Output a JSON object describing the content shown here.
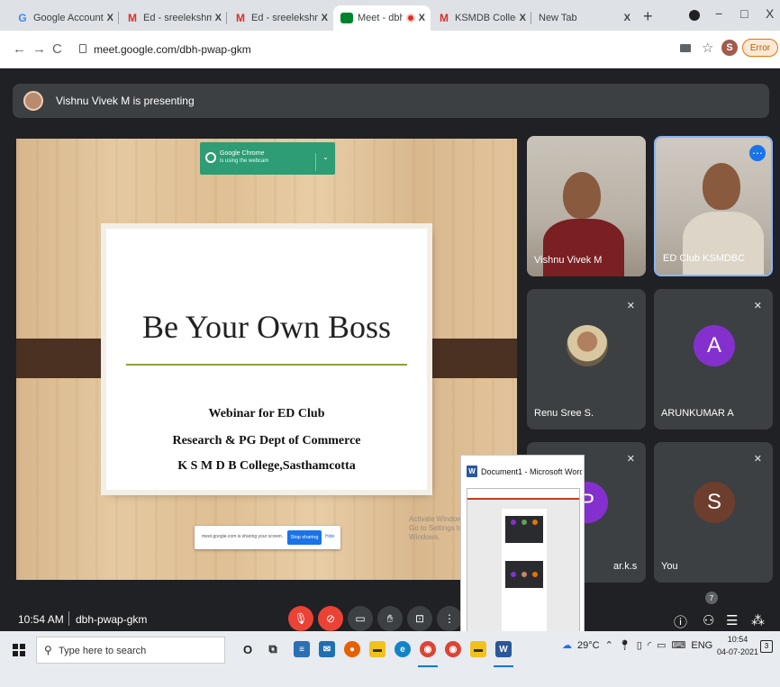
{
  "browser": {
    "tabs": [
      {
        "title": "Google Account",
        "favicon": "google-icon",
        "active": false
      },
      {
        "title": "Ed - sreelekshmyhg@",
        "favicon": "gmail-icon",
        "active": false
      },
      {
        "title": "Ed - sreelekshmyhg@",
        "favicon": "gmail-icon",
        "active": false
      },
      {
        "title": "Meet - dbh-pwap-",
        "favicon": "meet-icon",
        "active": true,
        "recording": true
      },
      {
        "title": "KSMDB College, Sasth",
        "favicon": "gmail-icon",
        "active": false
      },
      {
        "title": "New Tab",
        "favicon": "",
        "active": false
      }
    ],
    "close_glyph": "X",
    "new_tab_glyph": "+",
    "window_controls": {
      "minimize": "−",
      "maximize": "□",
      "close": "X"
    },
    "address": "meet.google.com/dbh-pwap-gkm",
    "profile_initial": "S",
    "error_label": "Error"
  },
  "meet": {
    "presenting_text": "Vishnu Vivek M is presenting",
    "notification": {
      "title": "Google Chrome",
      "subtitle": "is using the webcam"
    },
    "slide": {
      "title": "Be Your Own Boss",
      "line1": "Webinar for ED Club",
      "line2": "Research & PG Dept of Commerce",
      "line3": "K S M D B College,Sasthamcotta"
    },
    "share_bar": {
      "text": "meet.google.com is sharing your screen.",
      "stop_label": "Stop sharing",
      "hide_label": "Hide"
    },
    "watermark": {
      "line1": "Activate Windows",
      "line2": "Go to Settings to activate Windows."
    },
    "participants": [
      {
        "name": "Vishnu Vivek M",
        "type": "video"
      },
      {
        "name": "ED Club KSMDBC",
        "type": "video"
      },
      {
        "name": "Renu Sree S.",
        "type": "photo",
        "muted": true
      },
      {
        "name": "ARUNKUMAR A",
        "type": "initial",
        "initial": "A",
        "color": "#8430ce",
        "muted": true
      },
      {
        "name": "ar.k.s",
        "type": "initial",
        "initial": "P",
        "color": "#8430ce",
        "muted": true
      },
      {
        "name": "You",
        "type": "initial",
        "initial": "S",
        "color": "#6d3d2d",
        "muted": true
      }
    ],
    "word_preview_title": "Document1 - Microsoft Word (...",
    "time": "10:54 AM",
    "code": "dbh-pwap-gkm",
    "people_count": "7",
    "accent_red": "#ea4335"
  },
  "taskbar": {
    "search_placeholder": "Type here to search",
    "cortana_glyph": "O",
    "temperature": "29°C",
    "language": "ENG",
    "clock_time": "10:54",
    "clock_date": "04-07-2021",
    "notification_count": "3"
  }
}
